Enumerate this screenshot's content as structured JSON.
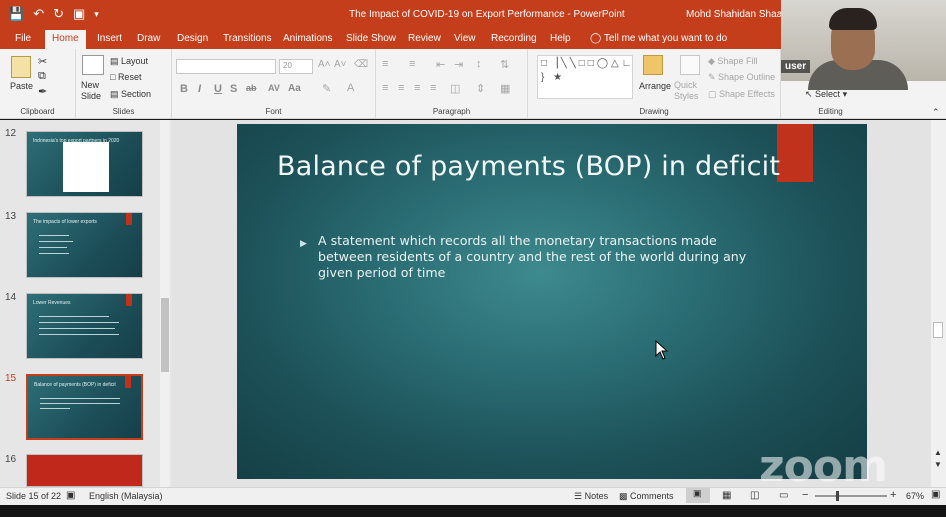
{
  "titlebar": {
    "document_title": "The Impact of COVID-19 on Export Performance  -  PowerPoint",
    "user_name": "Mohd Shahidan Shaari",
    "qat_icons": [
      "save-icon",
      "undo-icon",
      "redo-icon",
      "present-icon",
      "customize-icon"
    ]
  },
  "tabs": [
    {
      "label": "File"
    },
    {
      "label": "Home",
      "active": true
    },
    {
      "label": "Insert"
    },
    {
      "label": "Draw"
    },
    {
      "label": "Design"
    },
    {
      "label": "Transitions"
    },
    {
      "label": "Animations"
    },
    {
      "label": "Slide Show"
    },
    {
      "label": "Review"
    },
    {
      "label": "View"
    },
    {
      "label": "Recording"
    },
    {
      "label": "Help"
    }
  ],
  "tell_me": "Tell me what you want to do",
  "ribbon": {
    "clipboard": {
      "label": "Clipboard",
      "paste": "Paste"
    },
    "slides": {
      "label": "Slides",
      "new_slide": "New\nSlide",
      "layout": "Layout",
      "reset": "Reset",
      "section": "Section"
    },
    "font": {
      "label": "Font",
      "font_size": "20",
      "buttons": [
        "B",
        "I",
        "U",
        "S",
        "ab",
        "AV",
        "Aa"
      ]
    },
    "paragraph": {
      "label": "Paragraph"
    },
    "drawing": {
      "label": "Drawing",
      "arrange": "Arrange",
      "quick_styles": "Quick\nStyles",
      "shape_fill": "Shape Fill",
      "shape_outline": "Shape Outline",
      "shape_effects": "Shape Effects"
    },
    "editing": {
      "label": "Editing",
      "select": "Select"
    }
  },
  "webcam": {
    "user_label": "user"
  },
  "thumbnails": [
    {
      "number": "12",
      "title": "Indonesia's top export partners in 2020",
      "kind": "table"
    },
    {
      "number": "13",
      "title": "The impacts of lower exports",
      "kind": "bullets"
    },
    {
      "number": "14",
      "title": "Lower Revenues",
      "kind": "bullets"
    },
    {
      "number": "15",
      "title": "Balance of payments (BOP) in deficit",
      "kind": "bullets",
      "selected": true
    },
    {
      "number": "16",
      "title": "",
      "kind": "red"
    }
  ],
  "slide": {
    "title": "Balance of payments (BOP) in deficit",
    "bullet": "A statement which records all the monetary transactions made between residents of a country and the rest of the world during any given period of time"
  },
  "watermark": "zoom",
  "statusbar": {
    "slide_counter": "Slide 15 of 22",
    "language": "English (Malaysia)",
    "notes": "Notes",
    "comments": "Comments",
    "zoom": "67%"
  },
  "colors": {
    "ribbon_red": "#c43e1c",
    "slide_teal": "#2a6c73",
    "accent_red": "#c0321b"
  }
}
